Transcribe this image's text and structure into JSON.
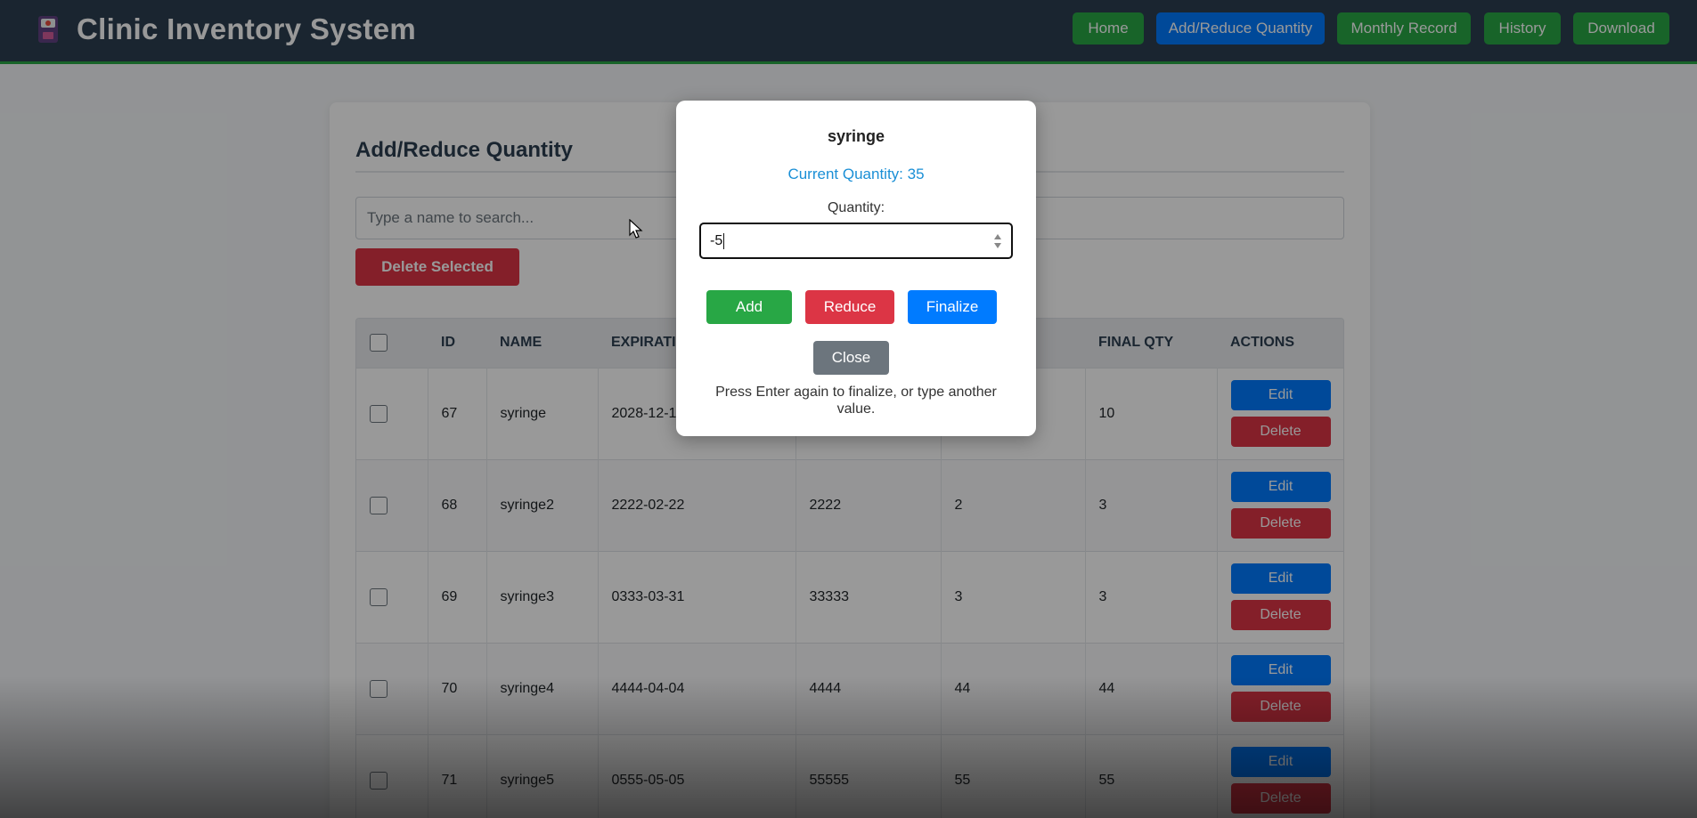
{
  "app": {
    "title": "Clinic Inventory System"
  },
  "nav": {
    "items": [
      {
        "label": "Home",
        "active": false
      },
      {
        "label": "Add/Reduce Quantity",
        "active": true
      },
      {
        "label": "Monthly Record",
        "active": false
      },
      {
        "label": "History",
        "active": false
      },
      {
        "label": "Download",
        "active": false
      }
    ]
  },
  "main": {
    "section_title": "Add/Reduce Quantity",
    "search_placeholder": "Type a name to search...",
    "delete_selected_label": "Delete Selected"
  },
  "table": {
    "columns": [
      "",
      "ID",
      "NAME",
      "EXPIRATIO",
      "",
      "",
      "FINAL QTY",
      "ACTIONS"
    ],
    "rows": [
      {
        "id": "67",
        "name": "syringe",
        "expiration": "2028-12-1",
        "col4": "",
        "col5": "",
        "final_qty": "10"
      },
      {
        "id": "68",
        "name": "syringe2",
        "expiration": "2222-02-22",
        "col4": "2222",
        "col5": "2",
        "final_qty": "3"
      },
      {
        "id": "69",
        "name": "syringe3",
        "expiration": "0333-03-31",
        "col4": "33333",
        "col5": "3",
        "final_qty": "3"
      },
      {
        "id": "70",
        "name": "syringe4",
        "expiration": "4444-04-04",
        "col4": "4444",
        "col5": "44",
        "final_qty": "44"
      },
      {
        "id": "71",
        "name": "syringe5",
        "expiration": "0555-05-05",
        "col4": "55555",
        "col5": "55",
        "final_qty": "55"
      }
    ],
    "edit_label": "Edit",
    "delete_label": "Delete"
  },
  "modal": {
    "item_name": "syringe",
    "current_quantity_text": "Current Quantity: 35",
    "quantity_label": "Quantity:",
    "quantity_value": "-5",
    "add_label": "Add",
    "reduce_label": "Reduce",
    "finalize_label": "Finalize",
    "close_label": "Close",
    "hint": "Press Enter again to finalize, or type another value."
  },
  "colors": {
    "header_bg": "#2c3e50",
    "success": "#28a745",
    "primary": "#007bff",
    "danger": "#dc3545",
    "secondary": "#6c757d"
  }
}
